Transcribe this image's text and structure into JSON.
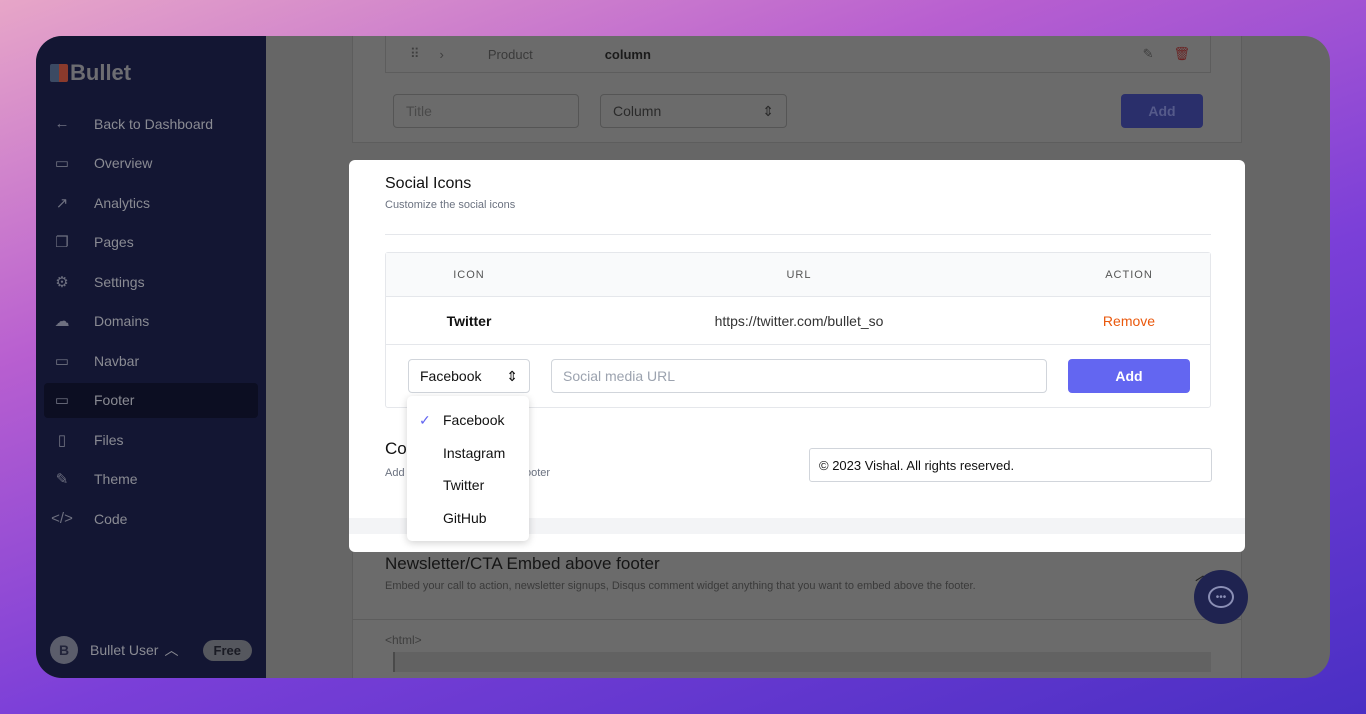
{
  "sidebar": {
    "brand": "Bullet",
    "items": [
      {
        "label": "Back to Dashboard",
        "icon": "arrow-left-icon"
      },
      {
        "label": "Overview",
        "icon": "presentation-icon"
      },
      {
        "label": "Analytics",
        "icon": "trend-icon"
      },
      {
        "label": "Pages",
        "icon": "pages-icon"
      },
      {
        "label": "Settings",
        "icon": "gear-icon"
      },
      {
        "label": "Domains",
        "icon": "cloud-icon"
      },
      {
        "label": "Navbar",
        "icon": "monitor-icon"
      },
      {
        "label": "Footer",
        "icon": "footer-icon"
      },
      {
        "label": "Files",
        "icon": "file-icon"
      },
      {
        "label": "Theme",
        "icon": "brush-icon"
      },
      {
        "label": "Code",
        "icon": "code-icon"
      }
    ],
    "active": "Footer",
    "user": {
      "initial": "B",
      "name": "Bullet User",
      "plan": "Free"
    }
  },
  "background": {
    "row": {
      "name": "Product",
      "type": "column"
    },
    "title_placeholder": "Title",
    "column_select": "Column",
    "add_label": "Add",
    "newsletter": {
      "title": "Newsletter/CTA Embed above footer",
      "desc": "Embed your call to action, newsletter signups, Disqus comment widget anything that you want to embed above the footer.",
      "code": "<html>"
    }
  },
  "modal": {
    "title": "Social Icons",
    "subtitle": "Customize the social icons",
    "columns": [
      "ICON",
      "URL",
      "ACTION"
    ],
    "rows": [
      {
        "icon": "Twitter",
        "url": "https://twitter.com/bullet_so",
        "action": "Remove"
      }
    ],
    "select_value": "Facebook",
    "url_placeholder": "Social media URL",
    "add_label": "Add",
    "options": [
      "Facebook",
      "Instagram",
      "Twitter",
      "GitHub"
    ],
    "copyright": {
      "title_partial": "Co",
      "desc_partial_left": "Add",
      "desc_partial_right": "ooter",
      "value": "© 2023 Vishal. All rights reserved."
    }
  },
  "colors": {
    "accent": "#6366f1",
    "remove": "#ea580c",
    "sidebar": "#131633"
  }
}
